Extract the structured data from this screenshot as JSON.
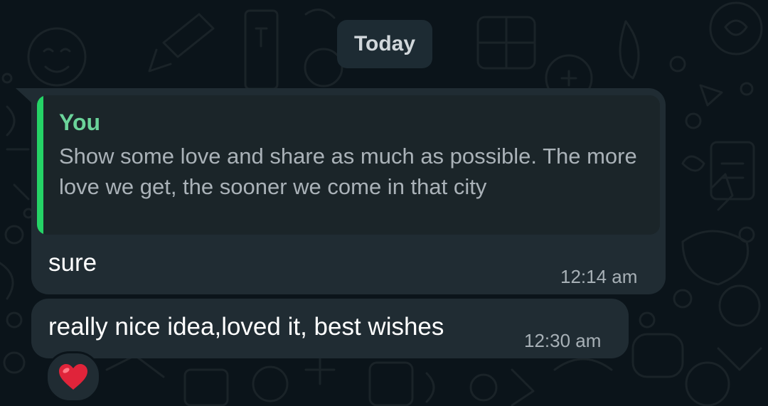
{
  "chat": {
    "date_separator": "Today",
    "messages": [
      {
        "quoted": {
          "author": "You",
          "text": "Show some love and share as much as possible. The more love we get, the sooner we come in that city"
        },
        "text": "sure",
        "time": "12:14 am"
      },
      {
        "text": "really nice idea,loved it, best wishes",
        "time": "12:30 am",
        "reaction": "heart-emoji"
      }
    ]
  },
  "theme": {
    "background": "#0b141a",
    "bubble": "#202c33",
    "quote_bar": "#25d366",
    "quote_author": "#6bd49a",
    "heart": "#e0243a"
  }
}
